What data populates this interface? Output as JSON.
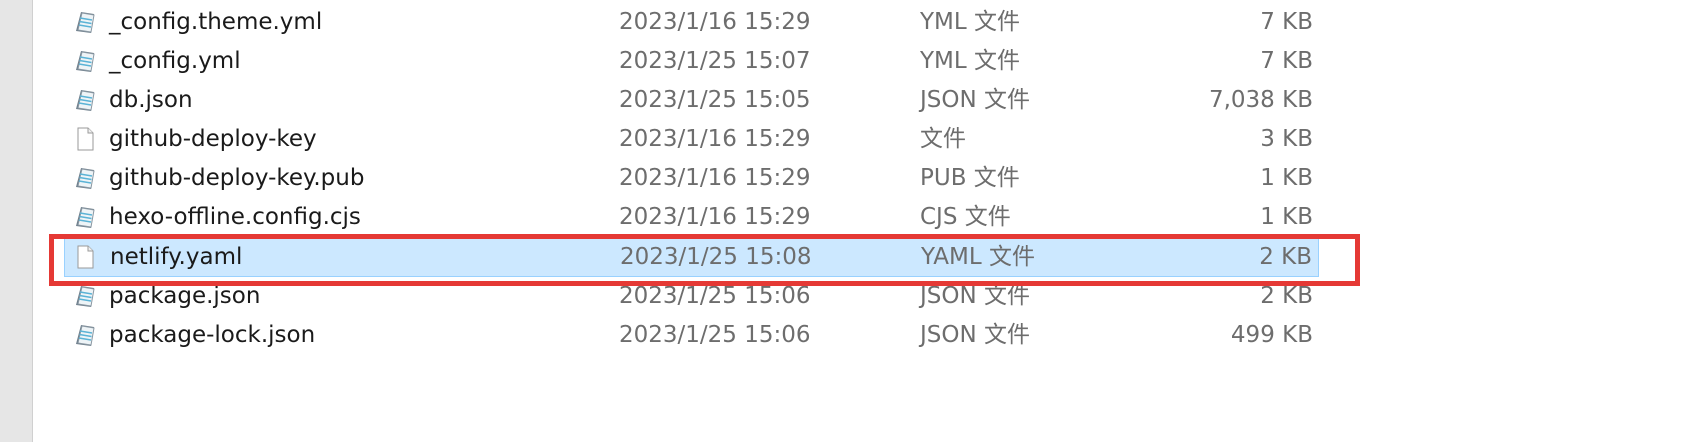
{
  "files": [
    {
      "name": "_config.theme.yml",
      "date": "2023/1/16 15:29",
      "type": "YML 文件",
      "size": "7 KB",
      "icon": "notepad-document-icon",
      "selected": false
    },
    {
      "name": "_config.yml",
      "date": "2023/1/25 15:07",
      "type": "YML 文件",
      "size": "7 KB",
      "icon": "notepad-document-icon",
      "selected": false
    },
    {
      "name": "db.json",
      "date": "2023/1/25 15:05",
      "type": "JSON 文件",
      "size": "7,038 KB",
      "icon": "notepad-document-icon",
      "selected": false
    },
    {
      "name": "github-deploy-key",
      "date": "2023/1/16 15:29",
      "type": "文件",
      "size": "3 KB",
      "icon": "blank-file-icon",
      "selected": false
    },
    {
      "name": "github-deploy-key.pub",
      "date": "2023/1/16 15:29",
      "type": "PUB 文件",
      "size": "1 KB",
      "icon": "notepad-document-icon",
      "selected": false
    },
    {
      "name": "hexo-offline.config.cjs",
      "date": "2023/1/16 15:29",
      "type": "CJS 文件",
      "size": "1 KB",
      "icon": "notepad-document-icon",
      "selected": false
    },
    {
      "name": "netlify.yaml",
      "date": "2023/1/25 15:08",
      "type": "YAML 文件",
      "size": "2 KB",
      "icon": "blank-file-icon",
      "selected": true
    },
    {
      "name": "package.json",
      "date": "2023/1/25 15:06",
      "type": "JSON 文件",
      "size": "2 KB",
      "icon": "notepad-document-icon",
      "selected": false
    },
    {
      "name": "package-lock.json",
      "date": "2023/1/25 15:06",
      "type": "JSON 文件",
      "size": "499 KB",
      "icon": "notepad-document-icon",
      "selected": false
    }
  ],
  "colors": {
    "selection_background": "#cce8ff",
    "selection_border": "#99d1ff",
    "highlight_annotation": "#e53935"
  }
}
